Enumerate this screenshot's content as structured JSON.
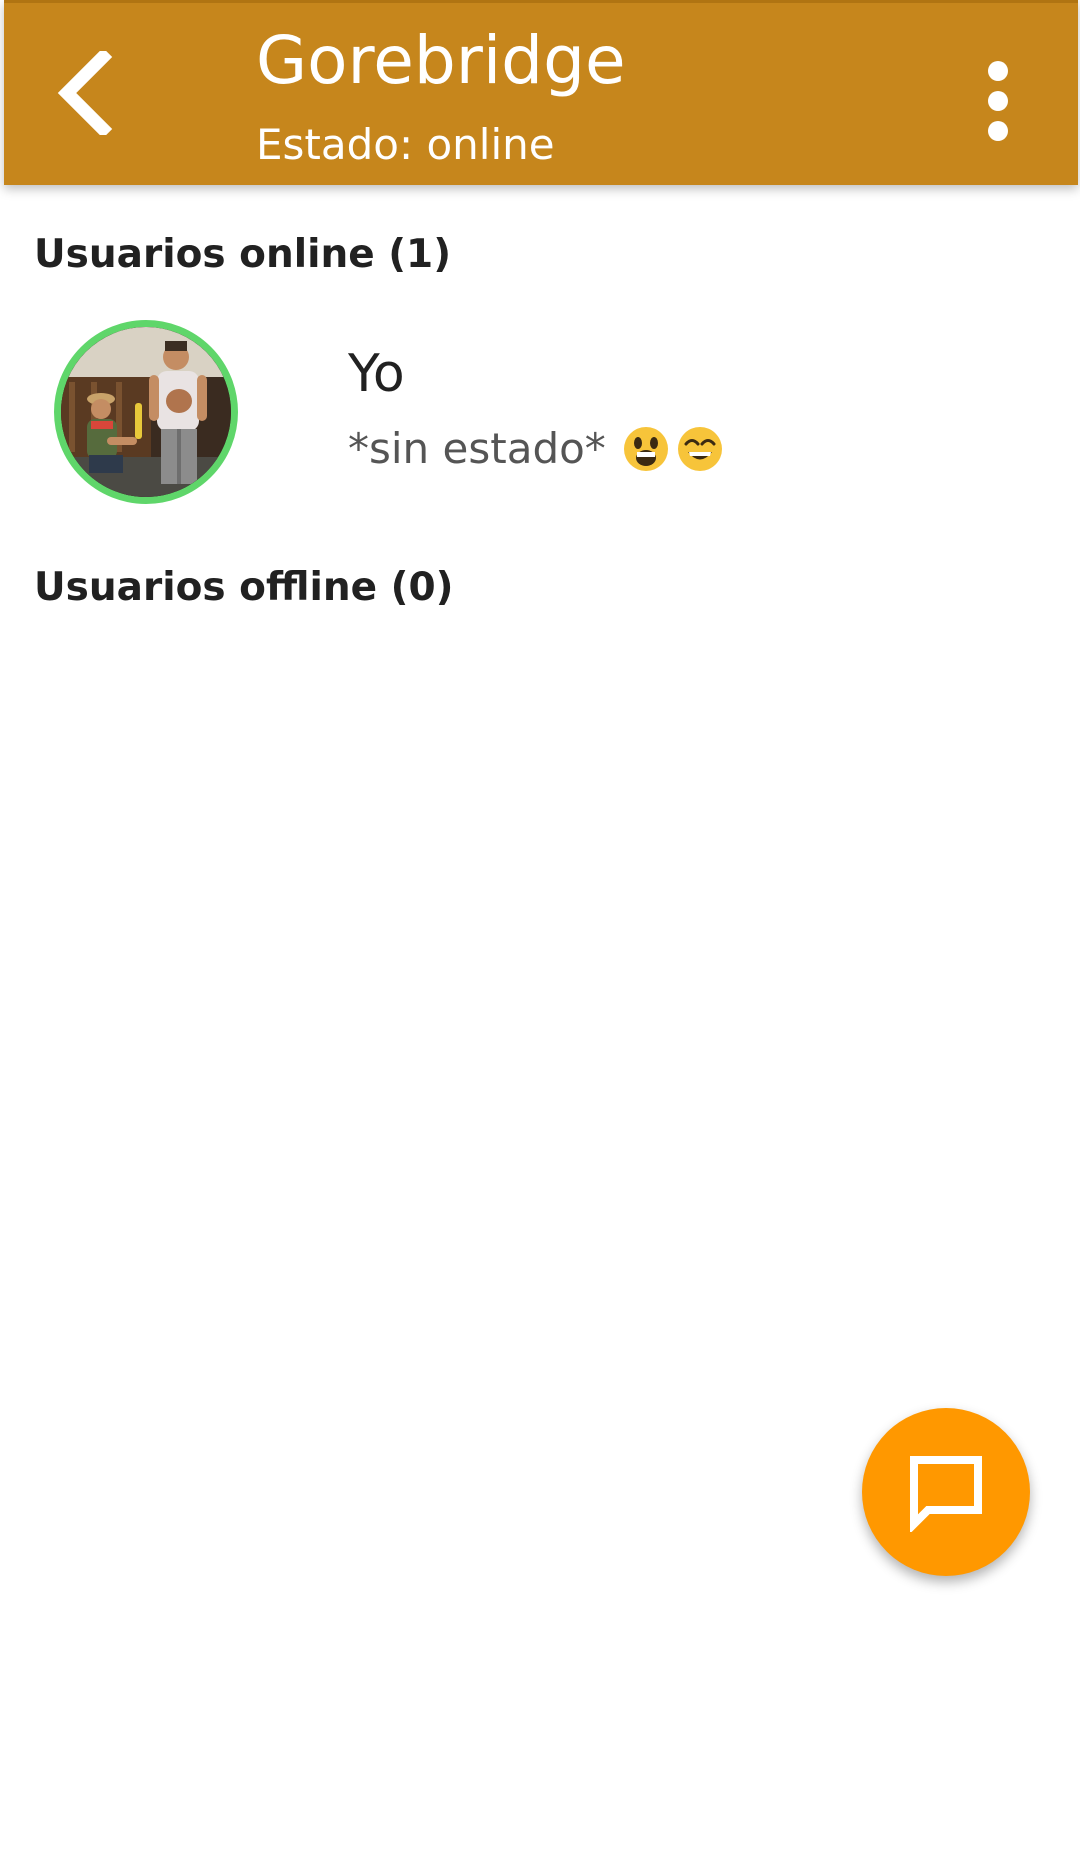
{
  "header": {
    "title": "Gorebridge",
    "subtitle": "Estado: online",
    "back_icon": "chevron-left-icon",
    "menu_icon": "more-vert-icon",
    "background_color": "#c6861c"
  },
  "sections": {
    "online": {
      "label": "Usuarios online (1)",
      "users": [
        {
          "name": "Yo",
          "status": "*sin estado*",
          "status_emojis": [
            "grinning-face-icon",
            "smiling-eyes-face-icon"
          ],
          "presence": "online",
          "presence_color": "#5fd66a"
        }
      ]
    },
    "offline": {
      "label": "Usuarios offline (0)",
      "users": []
    }
  },
  "fab": {
    "icon": "chat-message-icon",
    "color": "#ff9800"
  }
}
